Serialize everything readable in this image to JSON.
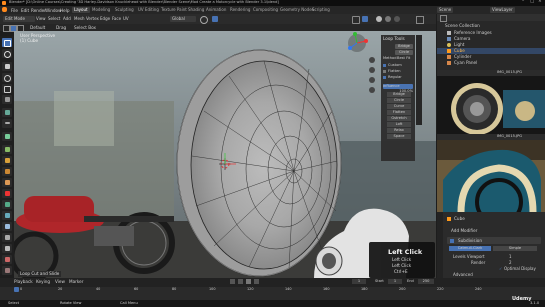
{
  "window": {
    "title": "Blender* [D:\\Online Courses\\Creating '3D Harley-Davidson Knucklehead with Blender\\Blender Scene\\Mod Create a Motorcycle with Blender 3.1\\blend]",
    "watermark": "Udemy"
  },
  "menu": {
    "items": [
      "File",
      "Edit",
      "Render",
      "Window",
      "Help"
    ],
    "workspaces": [
      "Layout",
      "Modeling",
      "Sculpting",
      "UV Editing",
      "Texture Paint",
      "Shading",
      "Animation",
      "Rendering",
      "Compositing",
      "Geometry Nodes",
      "Scripting"
    ],
    "scene": "Scene",
    "view_layer": "ViewLayer"
  },
  "header": {
    "mode": "Edit Mode",
    "buttons": [
      "View",
      "Select",
      "Add",
      "Mesh",
      "Vertex",
      "Edge",
      "Face",
      "UV"
    ],
    "orientation": "Global",
    "pivot": "Default",
    "drag": "Drag",
    "select": "Select Box"
  },
  "viewport": {
    "view_name": "User Perspective",
    "object_name": "(1) Cube",
    "status": "Loop Cut and Slide"
  },
  "sidepanel": {
    "header": "Loop Tools",
    "method_label": "Method",
    "method_value": "Best Fit",
    "checks": [
      "Custom",
      "Flatten",
      "Regular"
    ],
    "settings_label": "Influence",
    "settings_value": "100.0%",
    "buttons": [
      "Bridge",
      "Circle",
      "Curve",
      "Flatten",
      "Gstretch",
      "Loft",
      "Relax",
      "Space"
    ],
    "top_rows": [
      "Bridge",
      "Circle"
    ]
  },
  "keystrokes": {
    "title": "Left Click",
    "lines": [
      "Left Click",
      "Left Click",
      "Ctrl+E"
    ]
  },
  "outliner": {
    "title": "Scene Collection",
    "items": [
      "Reference Images",
      "Camera",
      "Light",
      "Cube",
      "Cylinder",
      "Cyan Panel"
    ]
  },
  "ref_labels": {
    "top": "IMG_0015.JPG",
    "bottom": "IMG_0015.JPG"
  },
  "properties": {
    "object": "Cube",
    "modifier_tab": "Add Modifier",
    "modifier_name": "Subdivision",
    "subtabs": [
      "Catmull-Clark",
      "Simple"
    ],
    "rows": [
      {
        "label": "Levels Viewport",
        "value": "1"
      },
      {
        "label": "Render",
        "value": "2"
      },
      {
        "label": "Optimal Display",
        "value": "✓"
      }
    ],
    "advanced": "Advanced"
  },
  "timeline": {
    "buttons": [
      "Playback",
      "Keying",
      "View",
      "Marker"
    ],
    "start_label": "Start",
    "start": "1",
    "end_label": "End",
    "end": "250",
    "current": "1",
    "ticks": [
      "0",
      "20",
      "40",
      "60",
      "80",
      "100",
      "120",
      "140",
      "160",
      "180",
      "200",
      "220",
      "240"
    ],
    "status_left": "Select",
    "status_mid": "Rotate View",
    "status_right": "Call Menu",
    "version": "3.1.0"
  },
  "colors": {
    "accent": "#4772b3",
    "active_object": "#ff9a1a",
    "bike_red": "#b0262a",
    "bg_dark": "#1d1d1d"
  }
}
